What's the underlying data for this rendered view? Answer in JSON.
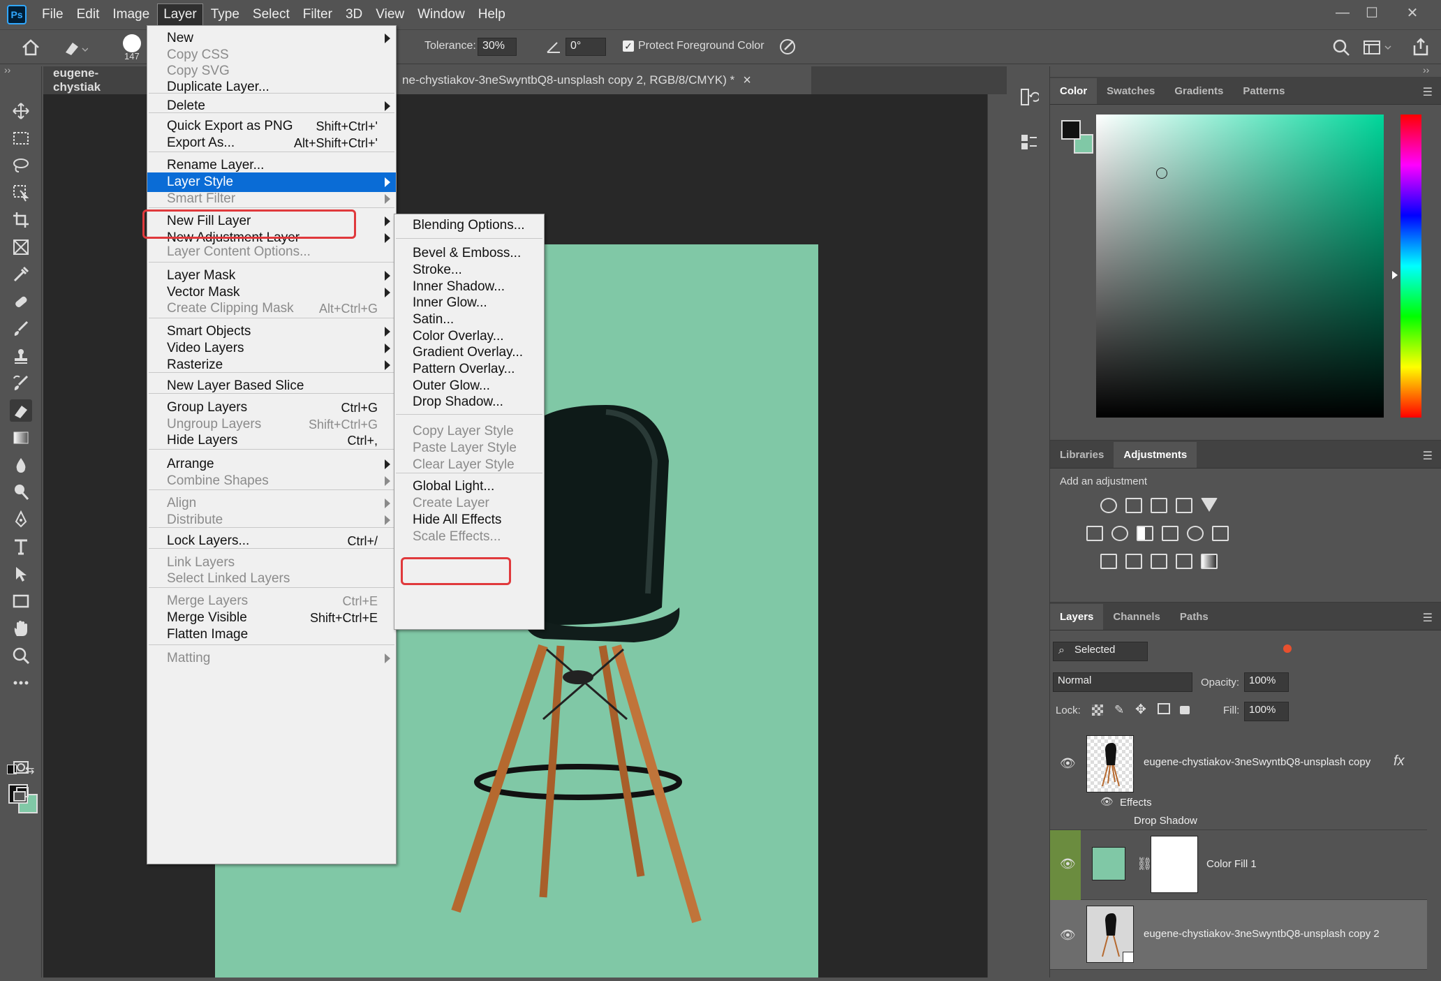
{
  "menubar": {
    "app_icon": "Ps",
    "items": [
      "File",
      "Edit",
      "Image",
      "Layer",
      "Type",
      "Select",
      "Filter",
      "3D",
      "View",
      "Window",
      "Help"
    ],
    "active": "Layer"
  },
  "window_controls": {
    "minimize": "—",
    "maximize": "☐",
    "close": "✕"
  },
  "options_bar": {
    "brush_size": "147",
    "tolerance_label": "Tolerance:",
    "tolerance_value": "30%",
    "angle_value": "0°",
    "protect_label": "Protect Foreground Color"
  },
  "tabs": {
    "left": "eugene-chystiak",
    "right": "ne-chystiakov-3neSwyntbQ8-unsplash copy 2, RGB/8/CMYK) *",
    "close": "×"
  },
  "layer_menu": {
    "items": [
      {
        "label": "New",
        "sub": true
      },
      {
        "label": "Copy CSS",
        "dis": true
      },
      {
        "label": "Copy SVG",
        "dis": true
      },
      {
        "label": "Duplicate Layer..."
      },
      {
        "label": "Delete",
        "sub": true
      },
      {
        "label": "Quick Export as PNG",
        "sc": "Shift+Ctrl+'"
      },
      {
        "label": "Export As...",
        "sc": "Alt+Shift+Ctrl+'"
      },
      {
        "label": "Rename Layer..."
      },
      {
        "label": "Layer Style",
        "sub": true,
        "hi": true
      },
      {
        "label": "Smart Filter",
        "sub": true,
        "dis": true
      },
      {
        "label": "New Fill Layer",
        "sub": true
      },
      {
        "label": "New Adjustment Layer",
        "sub": true
      },
      {
        "label": "Layer Content Options...",
        "dis": true
      },
      {
        "label": "Layer Mask",
        "sub": true
      },
      {
        "label": "Vector Mask",
        "sub": true
      },
      {
        "label": "Create Clipping Mask",
        "sc": "Alt+Ctrl+G",
        "dis": true
      },
      {
        "label": "Smart Objects",
        "sub": true
      },
      {
        "label": "Video Layers",
        "sub": true
      },
      {
        "label": "Rasterize",
        "sub": true
      },
      {
        "label": "New Layer Based Slice"
      },
      {
        "label": "Group Layers",
        "sc": "Ctrl+G"
      },
      {
        "label": "Ungroup Layers",
        "sc": "Shift+Ctrl+G",
        "dis": true
      },
      {
        "label": "Hide Layers",
        "sc": "Ctrl+,"
      },
      {
        "label": "Arrange",
        "sub": true
      },
      {
        "label": "Combine Shapes",
        "sub": true,
        "dis": true
      },
      {
        "label": "Align",
        "sub": true,
        "dis": true
      },
      {
        "label": "Distribute",
        "sub": true,
        "dis": true
      },
      {
        "label": "Lock Layers...",
        "sc": "Ctrl+/"
      },
      {
        "label": "Link Layers",
        "dis": true
      },
      {
        "label": "Select Linked Layers",
        "dis": true
      },
      {
        "label": "Merge Layers",
        "sc": "Ctrl+E",
        "dis": true
      },
      {
        "label": "Merge Visible",
        "sc": "Shift+Ctrl+E"
      },
      {
        "label": "Flatten Image"
      },
      {
        "label": "Matting",
        "sub": true,
        "dis": true
      }
    ]
  },
  "style_submenu": {
    "items": [
      {
        "label": "Blending Options..."
      },
      {
        "label": "Bevel & Emboss..."
      },
      {
        "label": "Stroke..."
      },
      {
        "label": "Inner Shadow..."
      },
      {
        "label": "Inner Glow..."
      },
      {
        "label": "Satin..."
      },
      {
        "label": "Color Overlay..."
      },
      {
        "label": "Gradient Overlay..."
      },
      {
        "label": "Pattern Overlay..."
      },
      {
        "label": "Outer Glow..."
      },
      {
        "label": "Drop Shadow..."
      },
      {
        "label": "Copy Layer Style",
        "dis": true
      },
      {
        "label": "Paste Layer Style",
        "dis": true
      },
      {
        "label": "Clear Layer Style",
        "dis": true
      },
      {
        "label": "Global Light..."
      },
      {
        "label": "Create Layer",
        "dis": true
      },
      {
        "label": "Hide All Effects"
      },
      {
        "label": "Scale Effects...",
        "dis": true
      }
    ]
  },
  "color_panel": {
    "tabs": [
      "Color",
      "Swatches",
      "Gradients",
      "Patterns"
    ],
    "active": "Color",
    "fg": "#111111",
    "bg": "#80c8a6",
    "hue": "#00d69a"
  },
  "adjust_panel": {
    "tabs": [
      "Libraries",
      "Adjustments"
    ],
    "active": "Adjustments",
    "hint": "Add an adjustment"
  },
  "layers_panel": {
    "tabs": [
      "Layers",
      "Channels",
      "Paths"
    ],
    "active": "Layers",
    "filter": "Selected",
    "blend": "Normal",
    "opacity_label": "Opacity:",
    "opacity": "100%",
    "lock_label": "Lock:",
    "fill_label": "Fill:",
    "fill": "100%",
    "layers": [
      {
        "name": "eugene-chystiakov-3neSwyntbQ8-unsplash copy",
        "fx": "fx",
        "effects_label": "Effects",
        "effect": "Drop Shadow"
      },
      {
        "name": "Color Fill 1"
      },
      {
        "name": "eugene-chystiakov-3neSwyntbQ8-unsplash copy 2"
      }
    ]
  }
}
